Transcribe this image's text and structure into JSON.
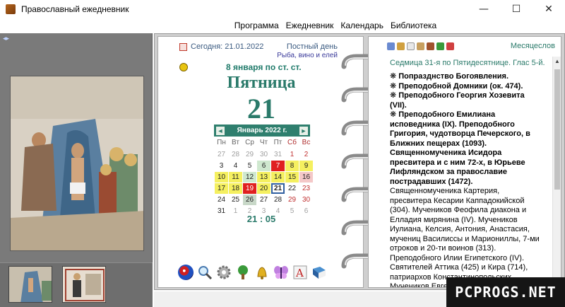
{
  "window": {
    "title": "Православный ежедневник",
    "controls": [
      "—",
      "☐",
      "✕"
    ]
  },
  "menu": [
    "Программа",
    "Ежедневник",
    "Календарь",
    "Библиотека"
  ],
  "left_page": {
    "today_label": "Сегодня: 21.01.2022",
    "fast_day": "Постный день",
    "fast_food": "Рыба, вино и елей",
    "old_style": "8 января по ст. ст.",
    "weekday": "Пятница",
    "day": "21",
    "time": "21 : 05",
    "calendar": {
      "month_label": "Январь 2022 г.",
      "prev_arrow": "◄",
      "next_arrow": "►",
      "days_of_week": [
        "Пн",
        "Вт",
        "Ср",
        "Чт",
        "Пт",
        "Сб",
        "Вс"
      ],
      "cells": [
        {
          "d": "27",
          "t": "gray"
        },
        {
          "d": "28",
          "t": "gray"
        },
        {
          "d": "29",
          "t": "gray"
        },
        {
          "d": "30",
          "t": "gray"
        },
        {
          "d": "31",
          "t": "gray"
        },
        {
          "d": "1",
          "t": "red"
        },
        {
          "d": "2",
          "t": "red"
        },
        {
          "d": "3",
          "t": ""
        },
        {
          "d": "4",
          "t": ""
        },
        {
          "d": "5",
          "t": ""
        },
        {
          "d": "6",
          "t": "lg"
        },
        {
          "d": "7",
          "t": "redbg"
        },
        {
          "d": "8",
          "t": "yellow"
        },
        {
          "d": "9",
          "t": "yellow"
        },
        {
          "d": "10",
          "t": "yellow"
        },
        {
          "d": "11",
          "t": "yellow"
        },
        {
          "d": "12",
          "t": "lg"
        },
        {
          "d": "13",
          "t": "yellow"
        },
        {
          "d": "14",
          "t": "yellow"
        },
        {
          "d": "15",
          "t": "yellow"
        },
        {
          "d": "16",
          "t": "pink"
        },
        {
          "d": "17",
          "t": "yellow"
        },
        {
          "d": "18",
          "t": "yellow"
        },
        {
          "d": "19",
          "t": "redbg"
        },
        {
          "d": "20",
          "t": "yellow"
        },
        {
          "d": "21",
          "t": "sel"
        },
        {
          "d": "22",
          "t": ""
        },
        {
          "d": "23",
          "t": "red"
        },
        {
          "d": "24",
          "t": ""
        },
        {
          "d": "25",
          "t": ""
        },
        {
          "d": "26",
          "t": "gbg"
        },
        {
          "d": "27",
          "t": ""
        },
        {
          "d": "28",
          "t": ""
        },
        {
          "d": "29",
          "t": "red"
        },
        {
          "d": "30",
          "t": "red"
        },
        {
          "d": "31",
          "t": ""
        },
        {
          "d": "1",
          "t": "gray"
        },
        {
          "d": "2",
          "t": "gray"
        },
        {
          "d": "3",
          "t": "gray"
        },
        {
          "d": "4",
          "t": "gray"
        },
        {
          "d": "5",
          "t": "gray"
        },
        {
          "d": "6",
          "t": "gray"
        }
      ]
    },
    "toolbar": [
      "globe-icon",
      "magnifier-icon",
      "gear-icon",
      "tree-icon",
      "bell-icon",
      "butterfly-icon",
      "font-icon",
      "book-icon"
    ]
  },
  "right_page": {
    "menologion_link": "Месяцеслов",
    "week_label": "Седмица 31-я по Пятидесятнице. Глас 5-й.",
    "saints_bold": [
      "❋ Попразднство Богоявления.",
      "❋ Преподобной Домники (ок. 474).",
      "❋ Преподобного Георгия Хозевита (VII).",
      "❋ Преподобного Емилиана исповедника (IX). Преподобного Григория, чудотворца Печерского, в Ближних пещерах (1093). Священномученика Исидора пресвитера и с ним 72-х, в Юрьеве Лифляндском за православие пострадавших (1472)."
    ],
    "saints_regular": "Священномученика Картерия, пресвитера Кесарии Каппадокийской (304). Мучеников Феофила диакона и Елладия мирянина (IV). Мучеников Иулиана, Келсия, Антония, Анастасия, мучениц Василиссы и Мариониллы, 7-ми отроков и 20-ти воинов (313). Преподобного Илии Египетского (IV). Святителей Аттика (425) и Кира (714), патриархов Константинопольских. Мучеников Евгения с Феофилом"
  },
  "watermark": "PCPROGS.NET",
  "colors": {
    "accent_green": "#2f7f6e",
    "text_teal": "#2a7a6a",
    "link_blue": "#3a5a80"
  }
}
